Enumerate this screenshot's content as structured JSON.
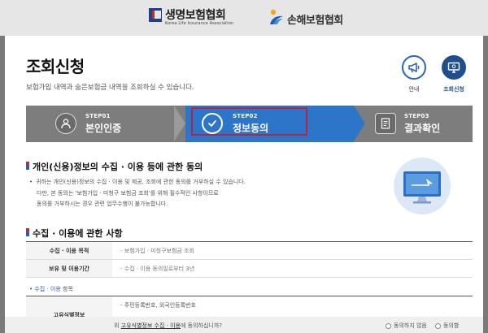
{
  "header": {
    "logo_life": {
      "name": "생명보험협회",
      "sub": "Korea Life Insurance Association"
    },
    "logo_nonlife": {
      "name": "손해보험협회"
    }
  },
  "page": {
    "title": "조회신청",
    "subtitle": "보험가입 내역과 숨은보험금 내역을 조회하실 수 있습니다."
  },
  "quick_buttons": {
    "guide": {
      "label": "안내",
      "icon": "megaphone-icon"
    },
    "inquiry": {
      "label": "조회신청",
      "icon": "monitor-icon"
    }
  },
  "steps": [
    {
      "no": "STEP01",
      "name": "본인인증",
      "icon": "person-icon",
      "active": false
    },
    {
      "no": "STEP02",
      "name": "정보동의",
      "icon": "check-circle-icon",
      "active": true
    },
    {
      "no": "STEP03",
      "name": "결과확인",
      "icon": "document-icon",
      "active": false
    }
  ],
  "section1": {
    "title": "개인(신용)정보의 수집 · 이용 등에 관한 동의",
    "lines": [
      "귀하는 개인(신용)정보의 수집 · 이용 및 제공, 조회에 관한 동의를 거부하실 수 있습니다.",
      "다만, 본 동의는 '보험가입 · 미청구 보험금 조회'를 위해 필수적인 사항이므로",
      "동의를 거부하시는 경우 관련 업무수행이 불가능합니다."
    ]
  },
  "section2": {
    "title": "수집 · 이용에 관한 사항",
    "rows": [
      {
        "header": "수집 · 이용 목적",
        "value": "- 보험가입 · 미청구보험금 조회"
      },
      {
        "header": "보유 및 이용기간",
        "value": "- 수집 · 이용 동의일로부터 3년"
      }
    ],
    "subhead": {
      "prefix": "• 수집 · 이용",
      "suffix": " 항목"
    },
    "items_row": {
      "header": "고유식별정보",
      "value": "- 주민등록번호, 외국인등록번호"
    }
  },
  "consent": {
    "question_prefix": "위 ",
    "question_link": "고유식별정보 수집 · 이용",
    "question_suffix": "에 동의하십니까?",
    "options": [
      "동의하지 않음",
      "동의함"
    ]
  },
  "colors": {
    "active_step": "#2d75c9",
    "inactive_step": "#7d7d7d",
    "highlight_border": "#b0264a",
    "brand_blue": "#1f4f8f"
  }
}
